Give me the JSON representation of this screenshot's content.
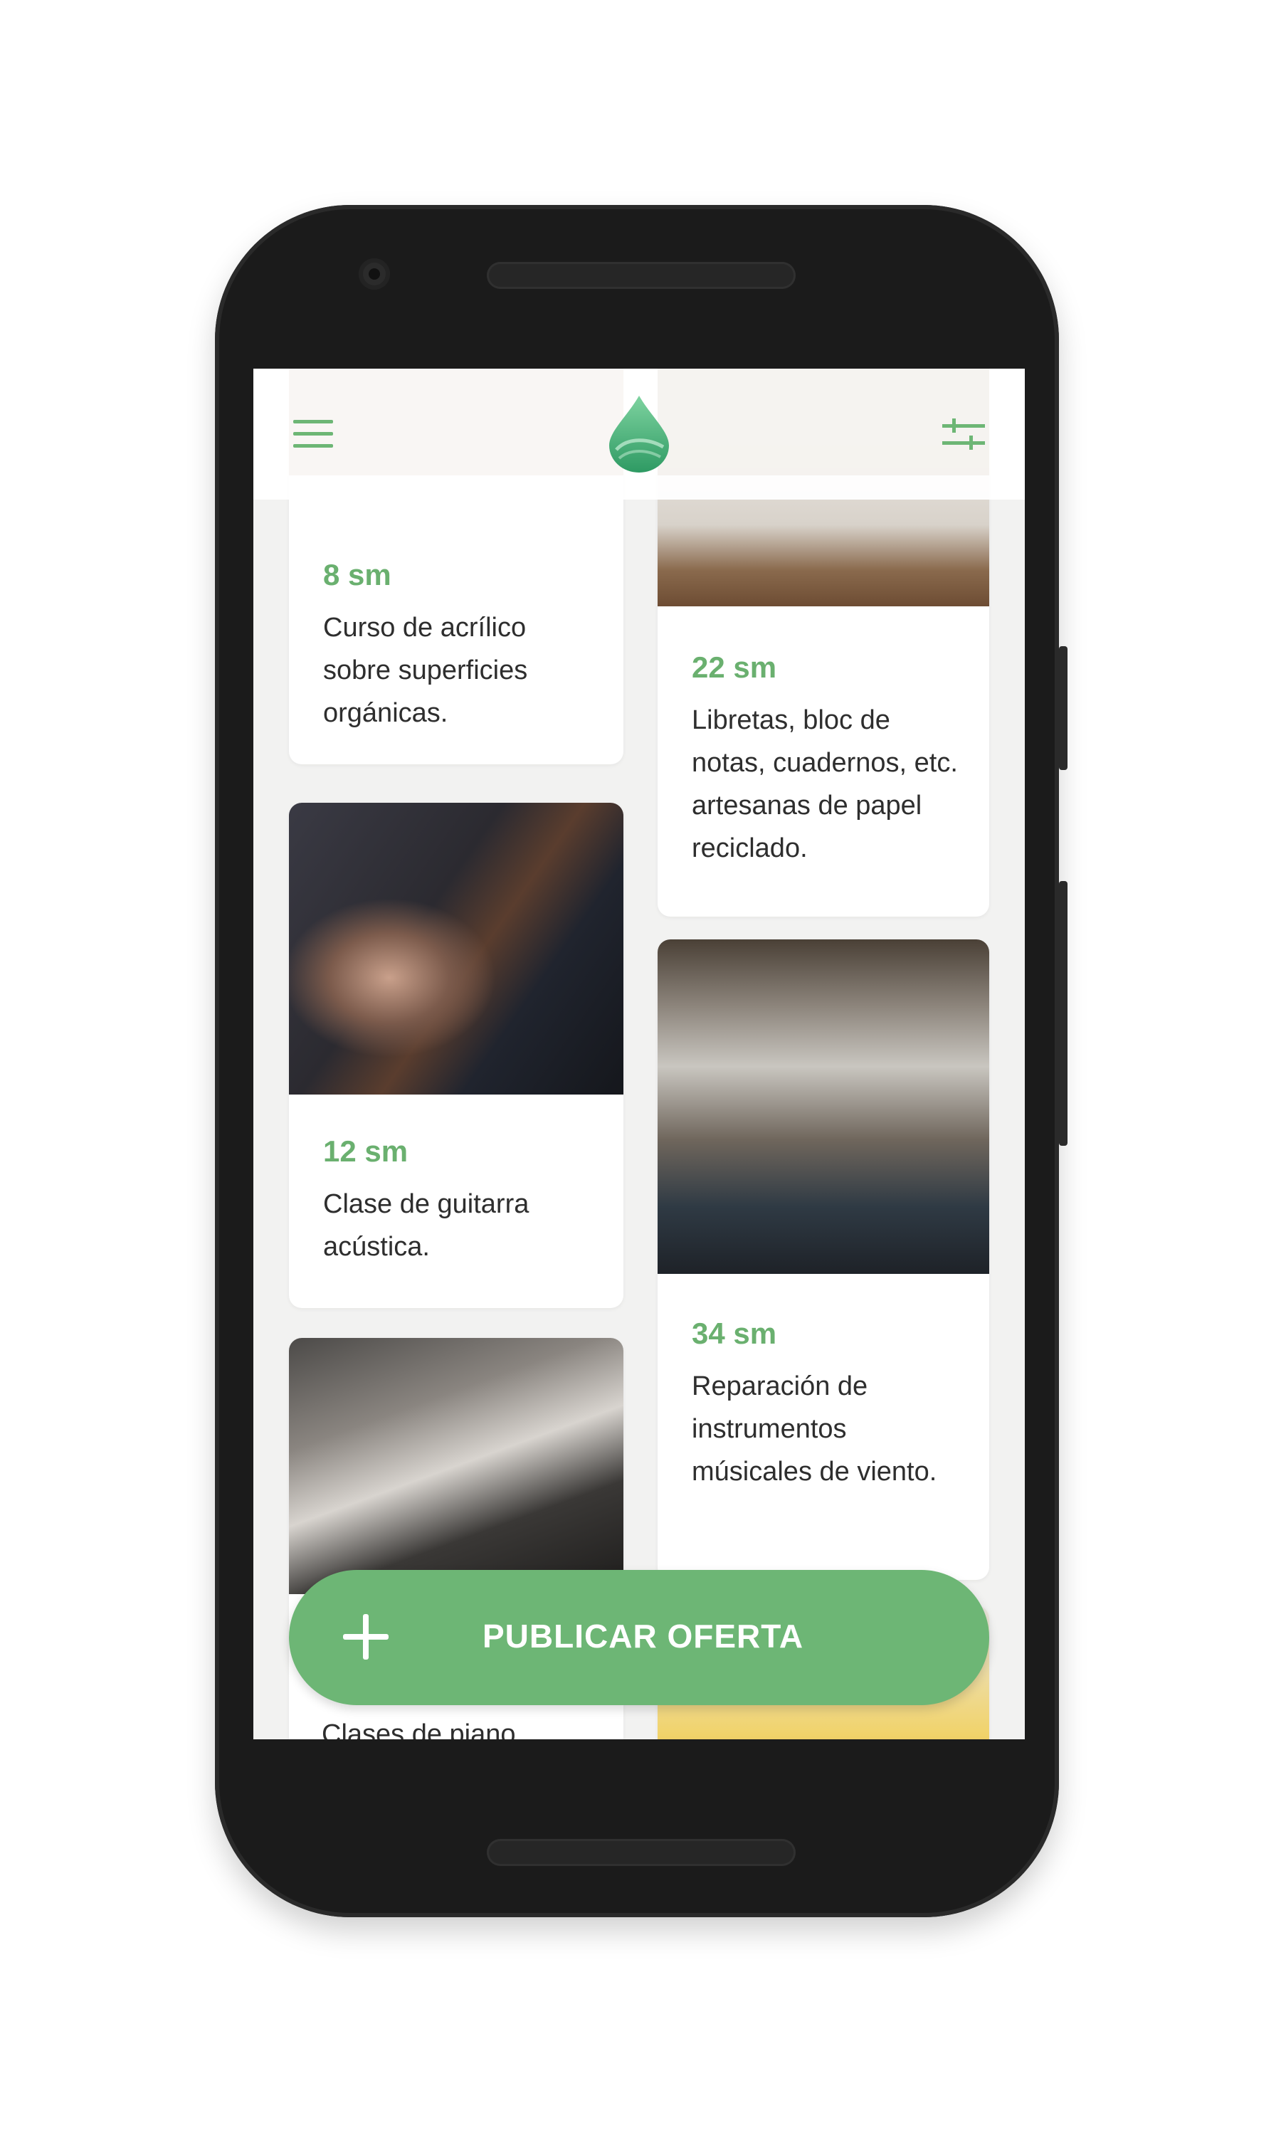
{
  "app": {
    "accent_color": "#6db675",
    "icons": {
      "menu": "hamburger-menu-icon",
      "logo": "green-drop-logo",
      "filters": "sliders-filter-icon",
      "add": "plus-icon"
    }
  },
  "offers": [
    {
      "price": "8 sm",
      "description": "Curso de acrílico sobre superficies orgánicas."
    },
    {
      "price": "22 sm",
      "description": "Libretas, bloc de notas, cuadernos, etc. artesanas de papel reciclado."
    },
    {
      "price": "12 sm",
      "description": "Clase de guitarra acústica."
    },
    {
      "price": "34 sm",
      "description": "Reparación de instrumentos músicales de viento."
    },
    {
      "price": "",
      "description": "Clases de piano"
    }
  ],
  "fab": {
    "label": "PUBLICAR OFERTA"
  }
}
